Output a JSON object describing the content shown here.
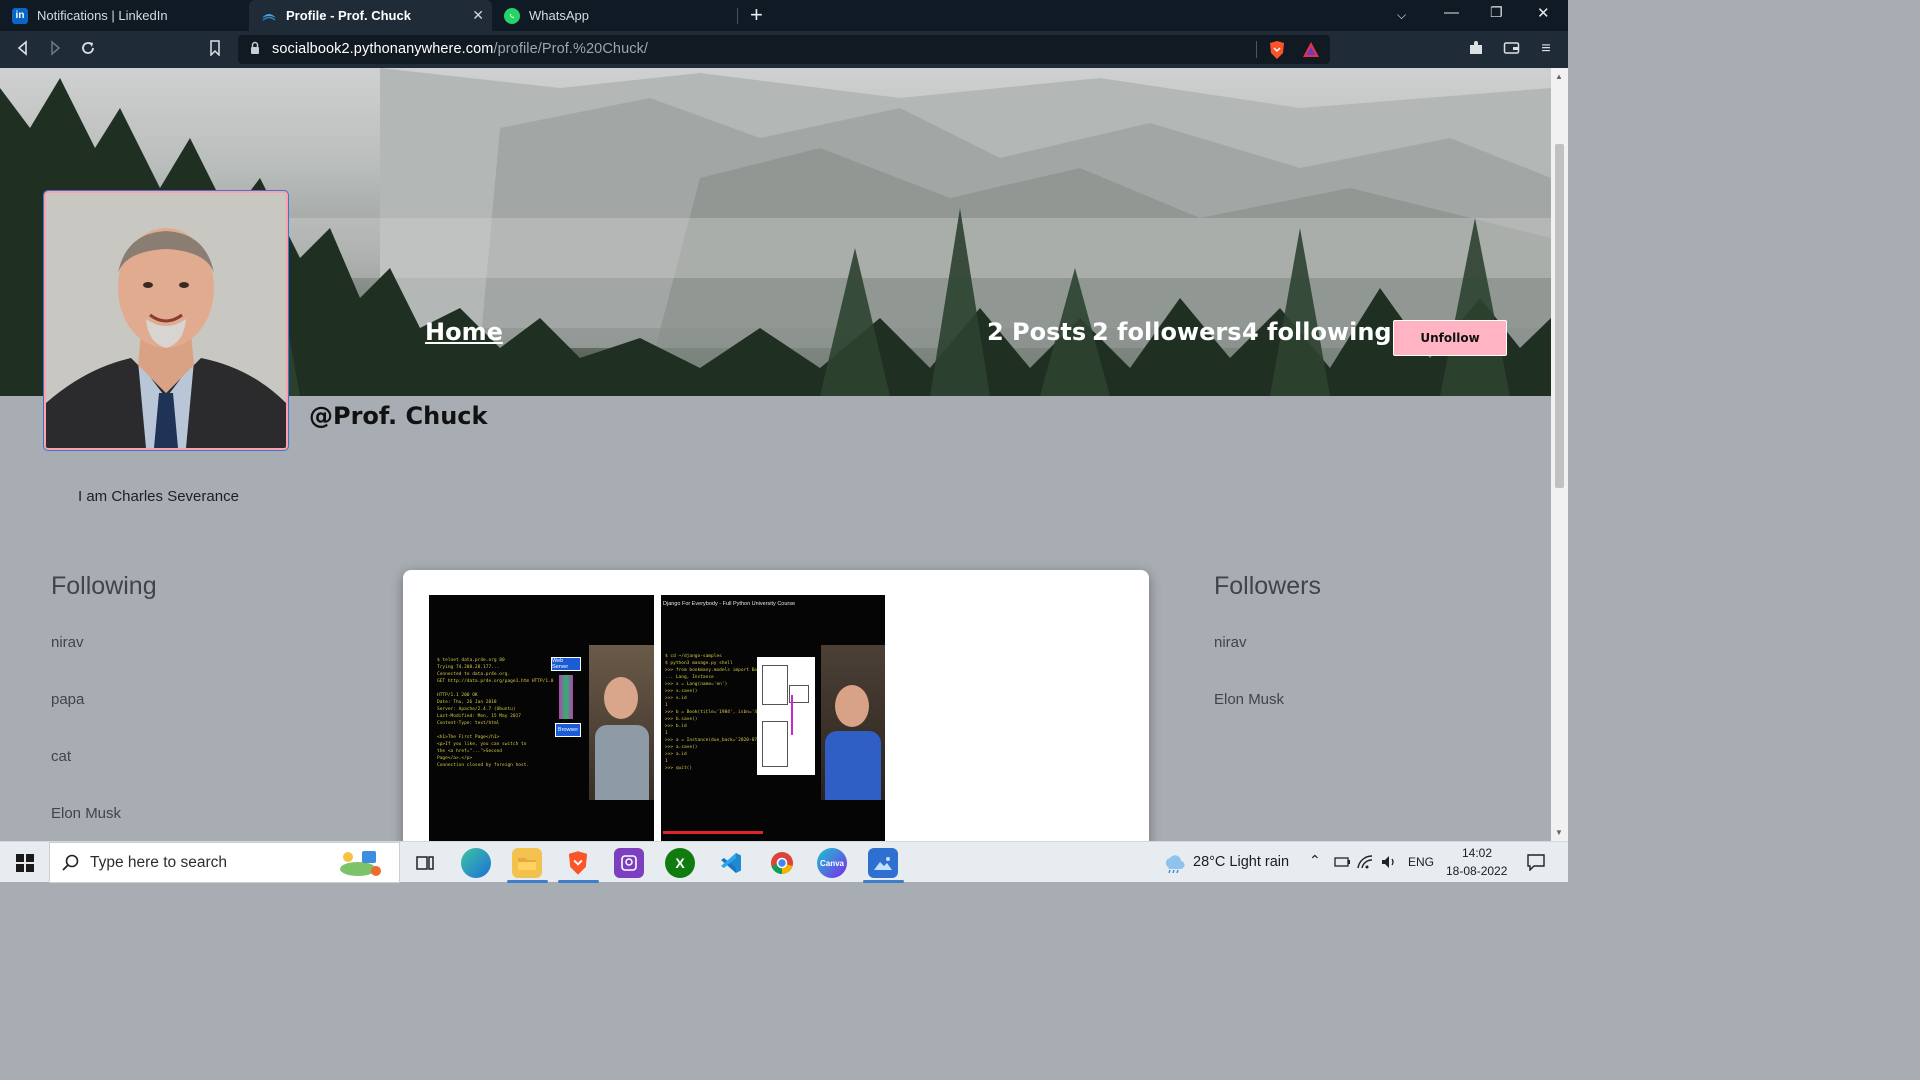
{
  "browser": {
    "tabs": [
      {
        "title": "Notifications | LinkedIn",
        "icon": "linkedin-icon"
      },
      {
        "title": "Profile - Prof. Chuck",
        "icon": "site-icon",
        "active": true
      },
      {
        "title": "WhatsApp",
        "icon": "whatsapp-icon"
      }
    ],
    "url_host": "socialbook2.pythonanywhere.com",
    "url_path": "/profile/Prof.%20Chuck/"
  },
  "profile": {
    "nav_home": "Home",
    "posts": "2 Posts",
    "followers": "2 followers",
    "following": "4 following",
    "action_button": "Unfollow",
    "username": "@Prof. Chuck",
    "bio": "I am Charles Severance",
    "following_title": "Following",
    "following_list": [
      "nirav",
      "papa",
      "cat",
      "Elon Musk"
    ],
    "followers_title": "Followers",
    "followers_list": [
      "nirav",
      "Elon Musk"
    ],
    "post2_caption": "Django For Everybody - Full Python University Course",
    "post1_labels": [
      "Web Server",
      "Browser"
    ]
  },
  "colors": {
    "unfollow_button": "#ffb3c3",
    "page_background": "#a8adb4",
    "avatar_border": "#ff9fb0"
  },
  "taskbar": {
    "search_placeholder": "Type here to search",
    "weather": "28°C  Light rain",
    "language": "ENG",
    "time": "14:02",
    "date": "18-08-2022"
  }
}
